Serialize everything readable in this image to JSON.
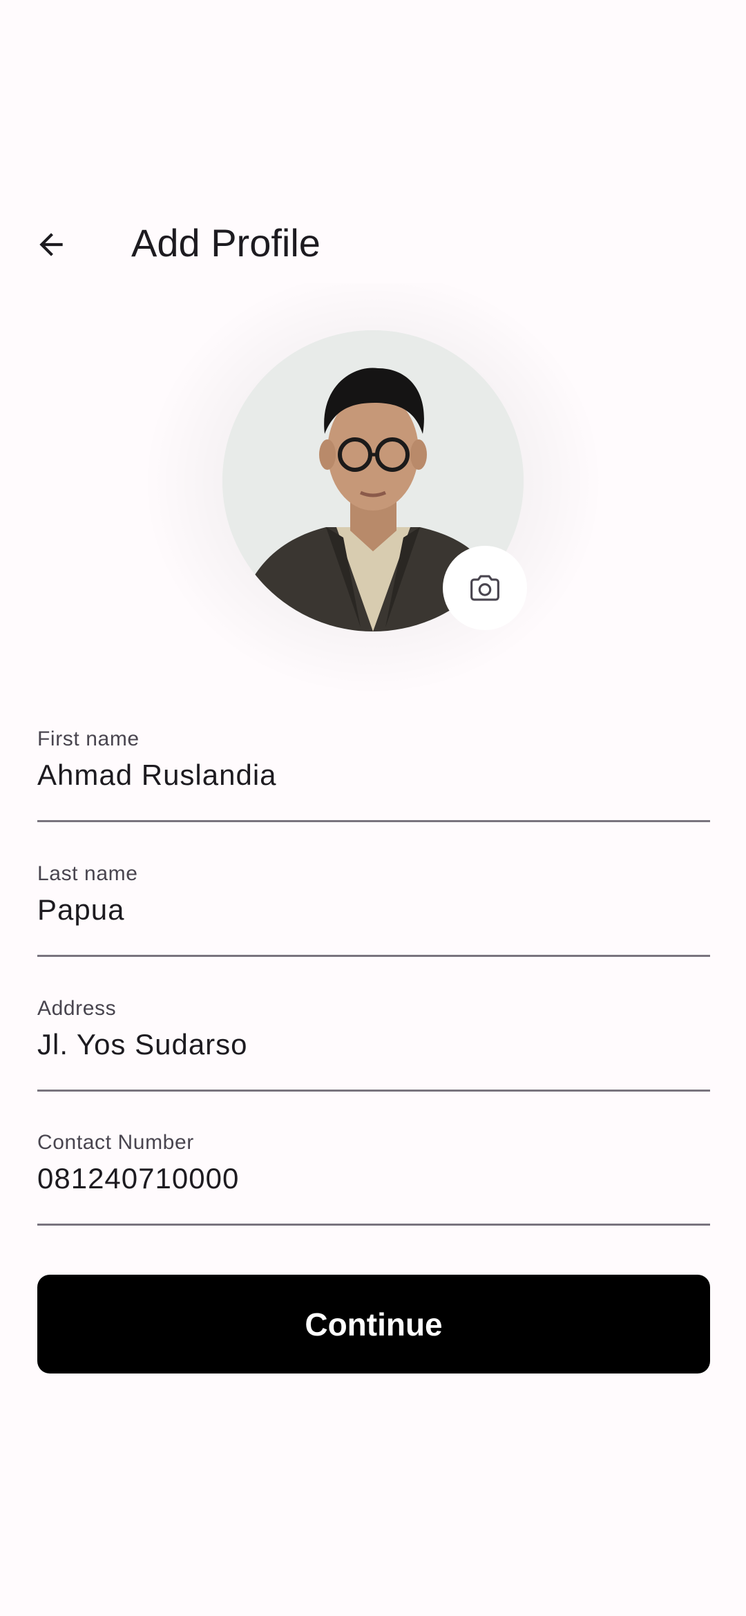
{
  "header": {
    "title": "Add Profile",
    "back_icon": "arrow-left-icon"
  },
  "avatar": {
    "camera_icon": "camera-icon"
  },
  "form": {
    "fields": [
      {
        "label": "First name",
        "value": "Ahmad Ruslandia"
      },
      {
        "label": "Last name",
        "value": "Papua"
      },
      {
        "label": "Address",
        "value": "Jl. Yos Sudarso"
      },
      {
        "label": "Contact Number",
        "value": "081240710000"
      }
    ],
    "continue_label": "Continue"
  },
  "colors": {
    "background": "#fffbfd",
    "primary_button": "#000000",
    "field_underline": "#79747e",
    "label_text": "#49454f"
  }
}
